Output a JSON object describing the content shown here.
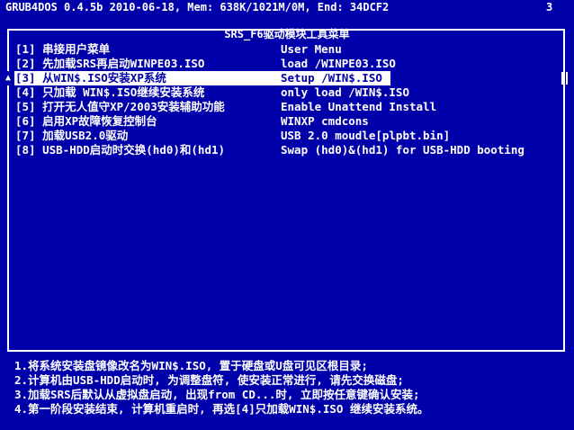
{
  "status_bar": {
    "text": "GRUB4DOS 0.4.5b 2010-06-18, Mem: 638K/1021M/0M, End: 34DCF2",
    "page": "3"
  },
  "menu": {
    "title": "SRS_F6驱动模块工具菜单",
    "selected_index": 2,
    "selection_marker": "▲",
    "items": [
      {
        "label": "[1] 串接用户菜单",
        "desc": "User Menu"
      },
      {
        "label": "[2] 先加载SRS再启动WINPE03.ISO",
        "desc": "load /WINPE03.ISO"
      },
      {
        "label": "[3] 从WIN$.ISO安装XP系统",
        "desc": "Setup /WIN$.ISO"
      },
      {
        "label": "[4] 只加载 WIN$.ISO继续安装系统",
        "desc": "only load /WIN$.ISO"
      },
      {
        "label": "[5] 打开无人值守XP/2003安装辅助功能",
        "desc": "Enable Unattend Install"
      },
      {
        "label": "[6] 启用XP故障恢复控制台",
        "desc": "WINXP cmdcons"
      },
      {
        "label": "[7] 加载USB2.0驱动",
        "desc": "USB 2.0 moudle[plpbt.bin]"
      },
      {
        "label": "[8] USB-HDD启动时交换(hd0)和(hd1)",
        "desc": "Swap (hd0)&(hd1) for USB-HDD booting"
      }
    ]
  },
  "hints": [
    "1.将系统安装盘镜像改名为WIN$.ISO, 置于硬盘或U盘可见区根目录;",
    "2.计算机由USB-HDD启动时, 为调整盘符, 使安装正常进行, 请先交换磁盘;",
    "3.加载SRS后默认从虚拟盘启动, 出现from CD...时, 立即按任意键确认安装;",
    "4.第一阶段安装结束, 计算机重启时, 再选[4]只加载WIN$.ISO 继续安装系统。"
  ],
  "colors": {
    "background": "#0000AA",
    "foreground": "#FFFFFF",
    "highlight_bg": "#FFFFFF",
    "highlight_fg": "#0000AA"
  }
}
